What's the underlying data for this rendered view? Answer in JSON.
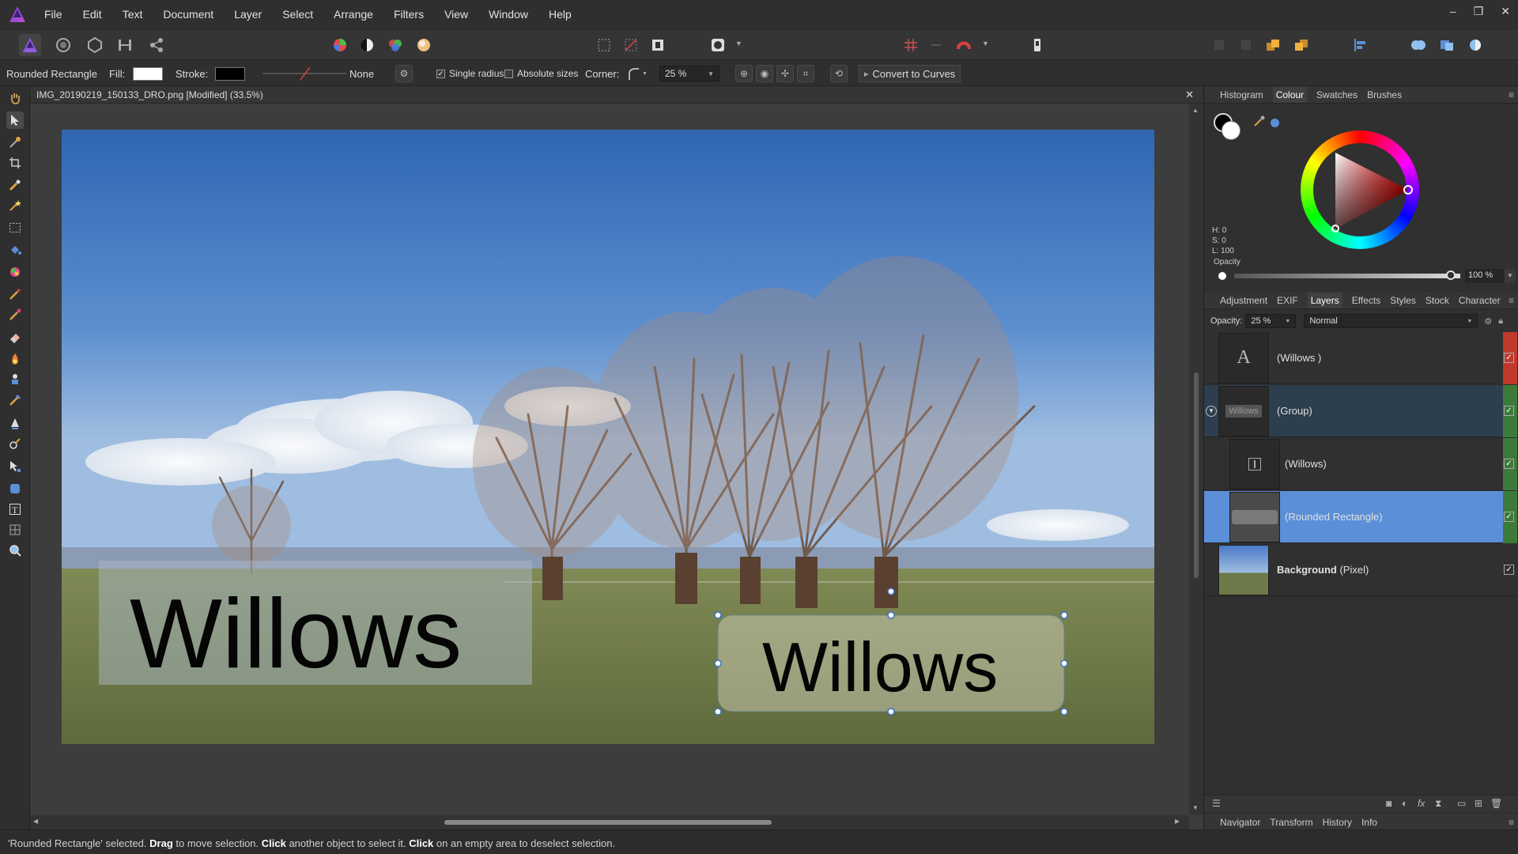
{
  "menubar": {
    "items": [
      "File",
      "Edit",
      "Text",
      "Document",
      "Layer",
      "Select",
      "Arrange",
      "Filters",
      "View",
      "Window",
      "Help"
    ],
    "minimize": "–",
    "restore": "❐",
    "close": "✕"
  },
  "context": {
    "tool_name": "Rounded Rectangle",
    "fill_label": "Fill:",
    "stroke_label": "Stroke:",
    "stroke_style": "None",
    "single_radius": "Single radius",
    "absolute_sizes": "Absolute sizes",
    "corner_label": "Corner:",
    "corner_value": "25 %",
    "convert_label": "Convert to Curves"
  },
  "document": {
    "tab_title": "IMG_20190219_150133_DRO.png [Modified] (33.5%)",
    "text_left": "Willows",
    "text_right": "Willows"
  },
  "colour_panel": {
    "tabs": [
      "Histogram",
      "Colour",
      "Swatches",
      "Brushes"
    ],
    "active": "Colour",
    "h": "H: 0",
    "s": "S: 0",
    "l": "L: 100",
    "opacity_label": "Opacity",
    "opacity_value": "100 %"
  },
  "layers_panel": {
    "tabs": [
      "Adjustment",
      "EXIF",
      "Layers",
      "Effects",
      "Styles",
      "Stock",
      "Character"
    ],
    "active": "Layers",
    "opacity_label": "Opacity:",
    "opacity_value": "25 %",
    "blend_mode": "Normal",
    "rows": [
      {
        "name": "(Willows )",
        "bold": "",
        "selected": false,
        "thumb": "A"
      },
      {
        "name": "(Group)",
        "bold": "",
        "selected": false,
        "thumb": "Willows"
      },
      {
        "name": "(Willows)",
        "bold": "",
        "selected": false,
        "thumb": ""
      },
      {
        "name": "(Rounded Rectangle)",
        "bold": "",
        "selected": true,
        "thumb": ""
      },
      {
        "name": "(Pixel)",
        "bold": "Background",
        "selected": false,
        "thumb": ""
      }
    ]
  },
  "bottom_tabs": [
    "Navigator",
    "Transform",
    "History",
    "Info"
  ],
  "status": {
    "part1": "'Rounded Rectangle' selected. ",
    "drag": "Drag",
    "part2": " to move selection. ",
    "click1": "Click",
    "part3": " another object to select it. ",
    "click2": "Click",
    "part4": " on an empty area to deselect selection."
  },
  "colors": {
    "accent": "#5b8fd8",
    "selected_layer": "#5b8fd8",
    "group_row": "#2d3e4e",
    "red_strip": "#c0392b",
    "green_strip": "#3d7a3a"
  },
  "icons": {
    "app": "affinity-photo-logo",
    "tools": [
      "hand-icon",
      "move-icon",
      "color-picker-icon",
      "crop-icon",
      "selection-brush-icon",
      "magic-wand-icon",
      "marquee-icon",
      "flood-fill-icon",
      "paint-mixer-icon",
      "paint-brush-icon",
      "retouch-brush-icon",
      "eraser-icon",
      "dodge-icon",
      "clone-icon",
      "healing-icon",
      "pen-icon",
      "node-icon",
      "shape-icon",
      "frame-text-icon",
      "artistic-text-icon",
      "mesh-warp-icon",
      "zoom-icon"
    ]
  }
}
